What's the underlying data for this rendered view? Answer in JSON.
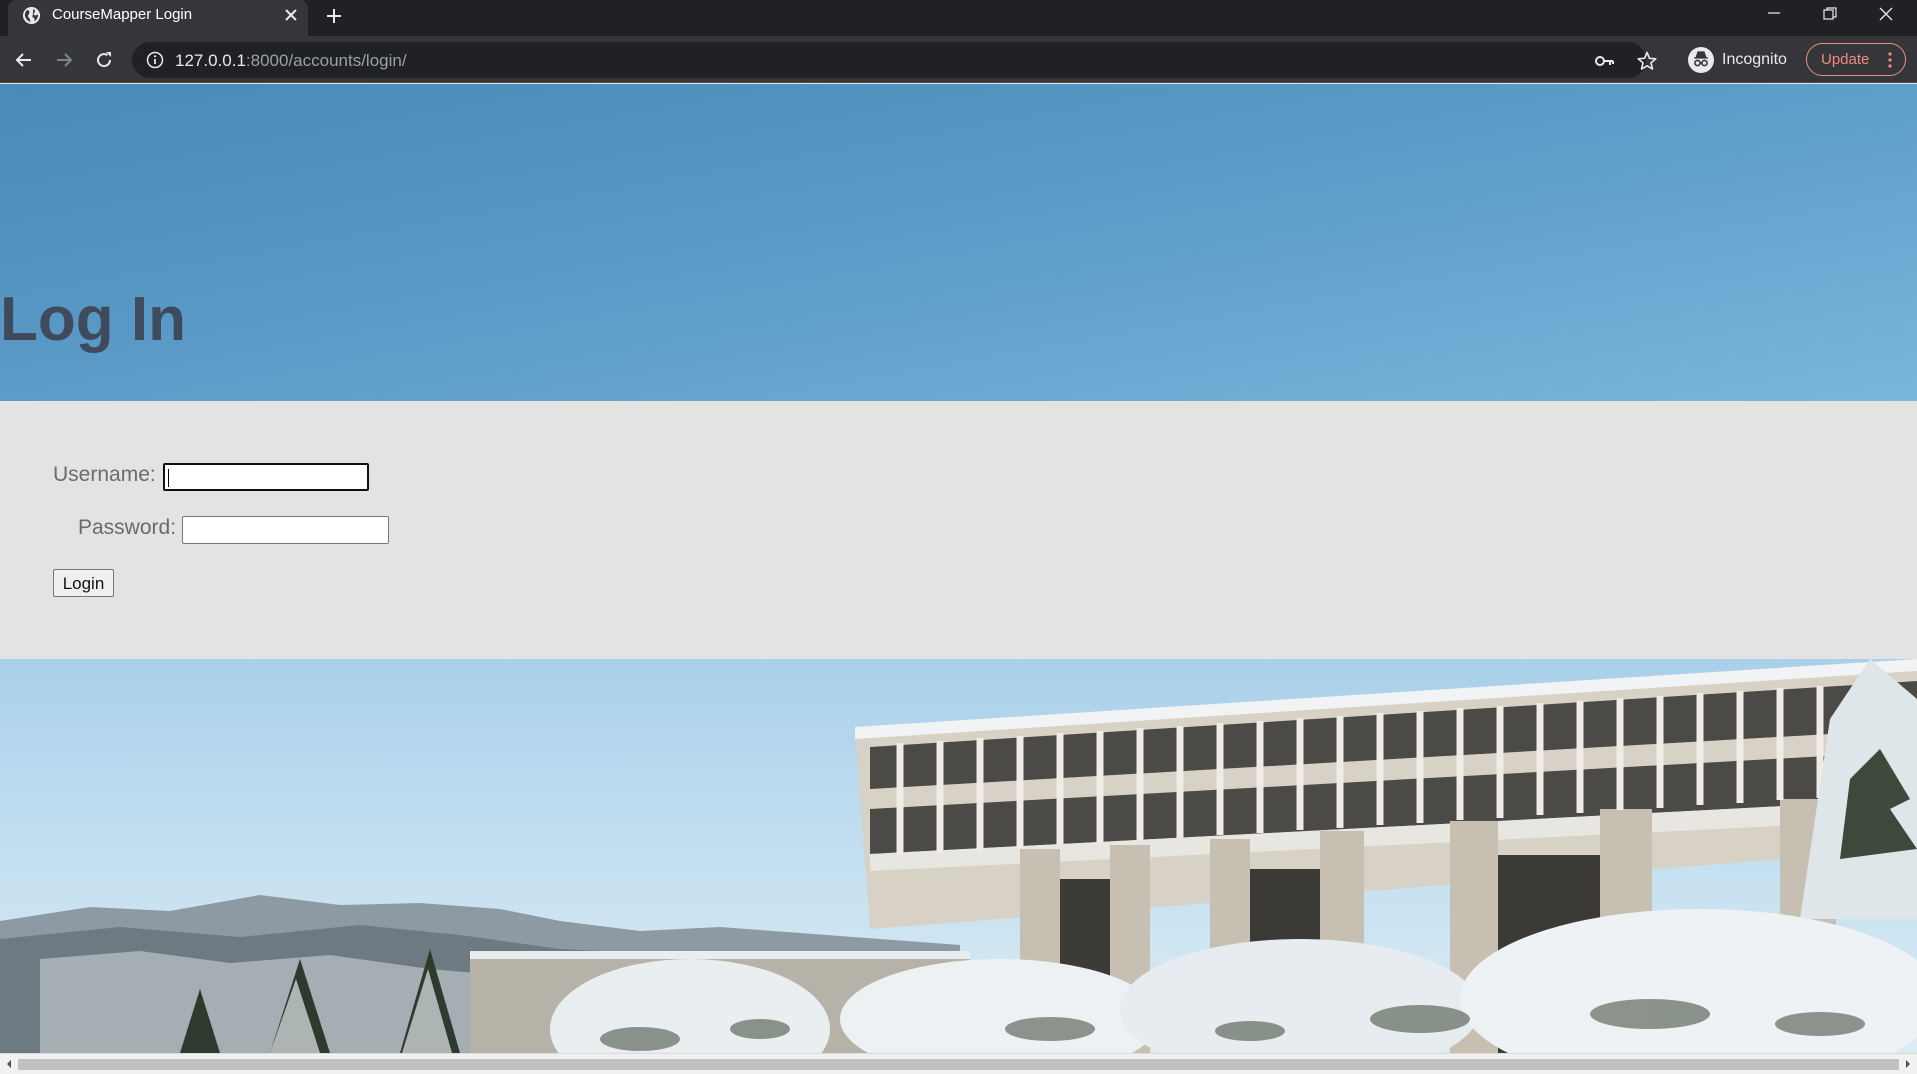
{
  "browser": {
    "tab": {
      "title": "CourseMapper Login",
      "favicon": "globe-icon"
    },
    "url": {
      "host": "127.0.0.1",
      "rest": ":8000/accounts/login/"
    },
    "profile_label": "Incognito",
    "update_label": "Update"
  },
  "page": {
    "title": "Log In",
    "form": {
      "username_label": "Username:",
      "username_value": "",
      "password_label": "Password:",
      "password_value": "",
      "submit_label": "Login"
    }
  },
  "colors": {
    "hero_sky": "#5b9ac7",
    "title_text": "#3f4a5c",
    "panel_bg": "#e4e3e2",
    "update_accent": "#f28b82"
  }
}
